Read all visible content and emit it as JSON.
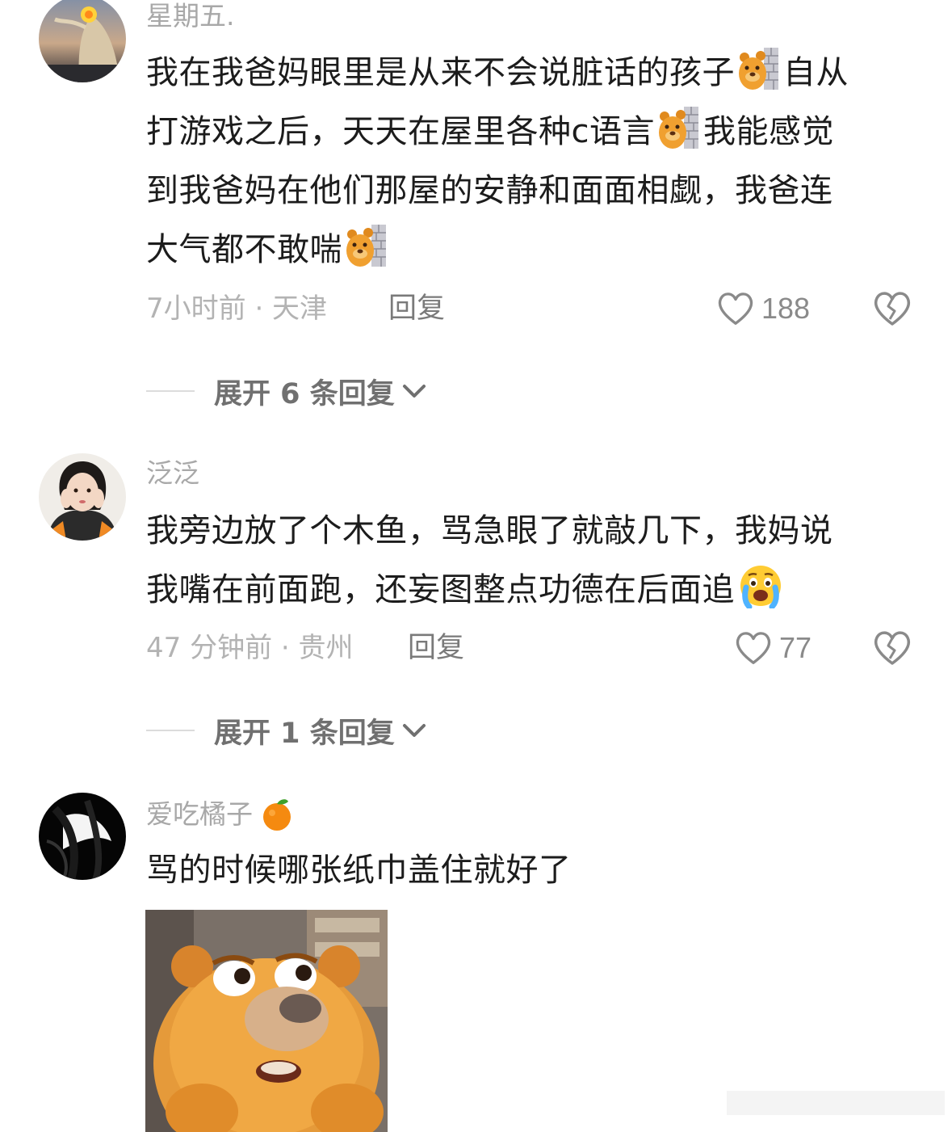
{
  "comments": [
    {
      "username": "星期五.",
      "lines": [
        "我在我爸妈眼里是从来不会说脏话的孩子",
        "自从",
        "打游戏之后，天天在屋里各种c语言",
        "我能感觉",
        "到我爸妈在他们那屋的安静和面面相觑，我爸连",
        "大气都不敢喘"
      ],
      "time_location": "7小时前 · 天津",
      "reply_label": "回复",
      "likes": "188",
      "expand_label": "展开 6 条回复",
      "emoji": "bear-peeking-wall-emoji"
    },
    {
      "username": "泛泛",
      "lines": [
        "我旁边放了个木鱼，骂急眼了就敲几下，我妈说",
        "我嘴在前面跑，还妄图整点功德在后面追"
      ],
      "time_location": "47 分钟前 · 贵州",
      "reply_label": "回复",
      "likes": "77",
      "expand_label": "展开 1 条回复",
      "emoji": "crying-face-emoji"
    },
    {
      "username": "爱吃橘子",
      "username_emoji": "tangerine-emoji",
      "lines": [
        "骂的时候哪张纸巾盖住就好了"
      ],
      "image": "bear-cartoon-sticker"
    }
  ],
  "colors": {
    "username": "#a8a8a8",
    "meta": "#b3b3b3",
    "text": "#1c1c1c",
    "icon": "#8a8a8a"
  }
}
